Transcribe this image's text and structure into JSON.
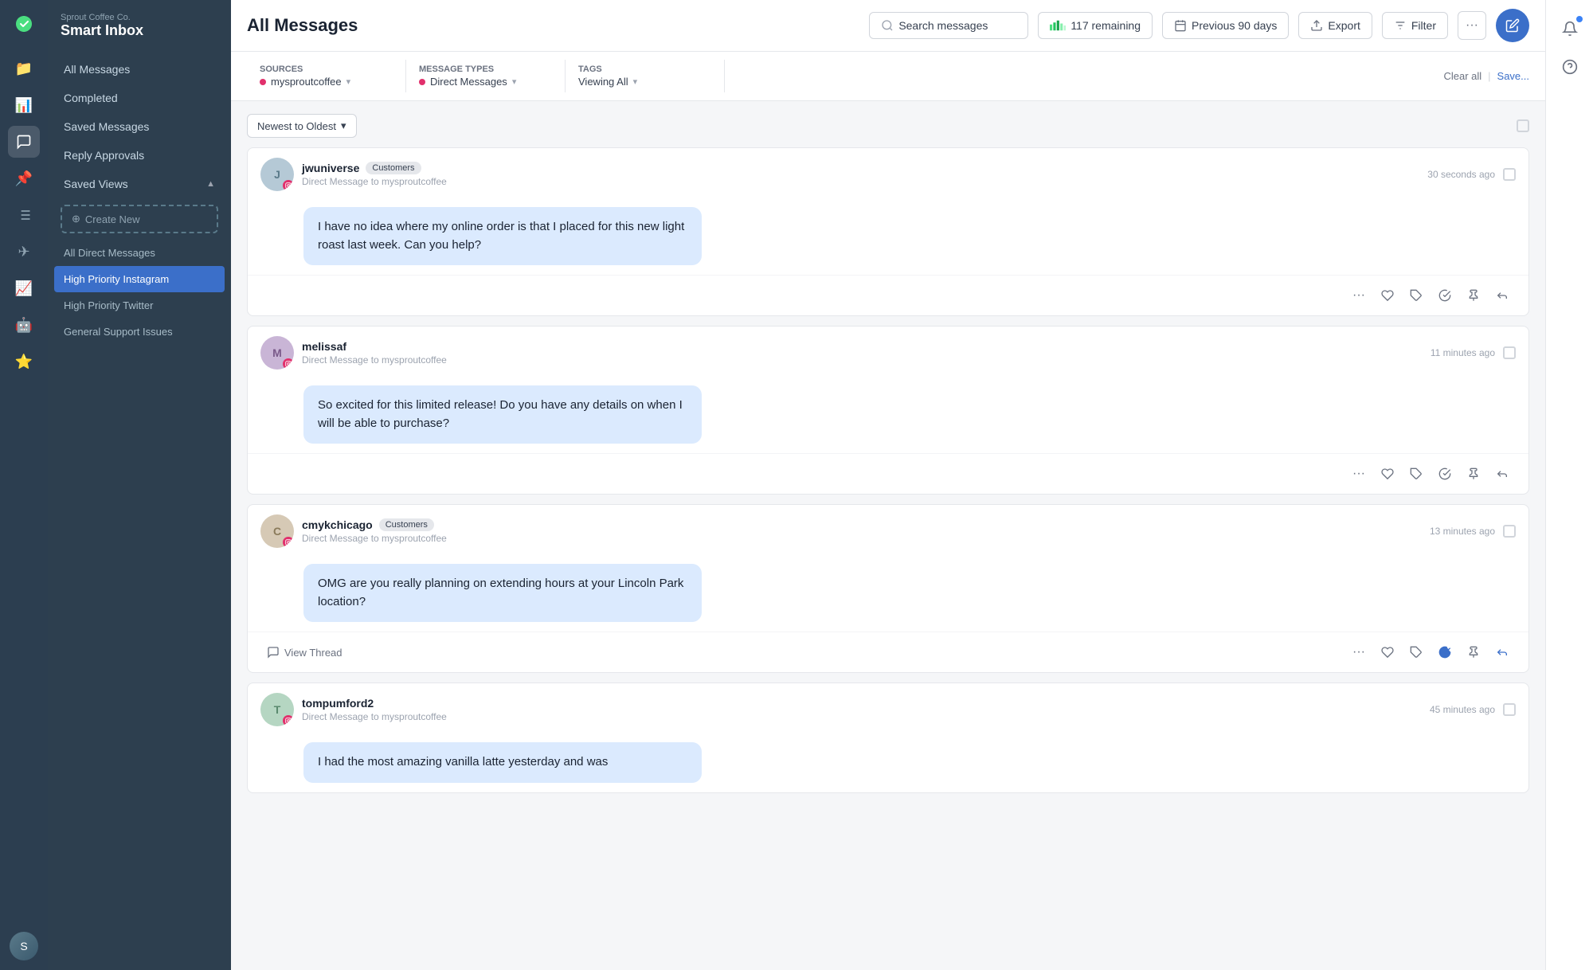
{
  "brand": {
    "company": "Sprout Coffee Co.",
    "app_name": "Smart Inbox"
  },
  "nav": {
    "icons": [
      "📁",
      "📊",
      "💬",
      "📌",
      "📋",
      "✈",
      "📈",
      "🤖",
      "⭐"
    ]
  },
  "sidebar": {
    "items": [
      {
        "label": "All Messages",
        "active": false
      },
      {
        "label": "Completed",
        "active": false
      },
      {
        "label": "Saved Messages",
        "active": false
      },
      {
        "label": "Reply Approvals",
        "active": false
      }
    ],
    "saved_views_label": "Saved Views",
    "create_new_label": "Create New",
    "sub_items": [
      {
        "label": "All Direct Messages",
        "active": false
      },
      {
        "label": "High Priority Instagram",
        "active": true
      },
      {
        "label": "High Priority Twitter",
        "active": false
      },
      {
        "label": "General Support Issues",
        "active": false
      }
    ]
  },
  "topbar": {
    "title": "All Messages",
    "search_placeholder": "Search messages",
    "remaining_count": "117 remaining",
    "prev_days": "Previous 90 days",
    "export_label": "Export",
    "filter_label": "Filter"
  },
  "filter_bar": {
    "sources_label": "Sources",
    "sources_value": "mysproutcoffee",
    "message_types_label": "Message Types",
    "message_types_value": "Direct Messages",
    "tags_label": "Tags",
    "tags_value": "Viewing All",
    "clear_all": "Clear all",
    "save": "Save..."
  },
  "sort": {
    "label": "Newest to Oldest"
  },
  "messages": [
    {
      "username": "jwuniverse",
      "tag": "Customers",
      "sub": "Direct Message to mysproutcoffee",
      "time": "30 seconds ago",
      "text": "I have no idea where my online order is that I placed for this new light roast last week. Can you help?",
      "completed": false,
      "avatar_color": "#b5c9d6",
      "has_thread": false
    },
    {
      "username": "melissaf",
      "tag": "",
      "sub": "Direct Message to mysproutcoffee",
      "time": "11 minutes ago",
      "text": "So excited for this limited release! Do you have any details on when I will be able to purchase?",
      "completed": false,
      "avatar_color": "#c9b5d6",
      "has_thread": false
    },
    {
      "username": "cmykchicago",
      "tag": "Customers",
      "sub": "Direct Message to mysproutcoffee",
      "time": "13 minutes ago",
      "text": "OMG are you really planning on extending hours at your Lincoln Park location?",
      "completed": true,
      "avatar_color": "#d6c9b5",
      "has_thread": true
    },
    {
      "username": "tompumford2",
      "tag": "",
      "sub": "Direct Message to mysproutcoffee",
      "time": "45 minutes ago",
      "text": "I had the most amazing vanilla latte yesterday and was",
      "completed": false,
      "avatar_color": "#b5d6c2",
      "has_thread": false
    }
  ]
}
